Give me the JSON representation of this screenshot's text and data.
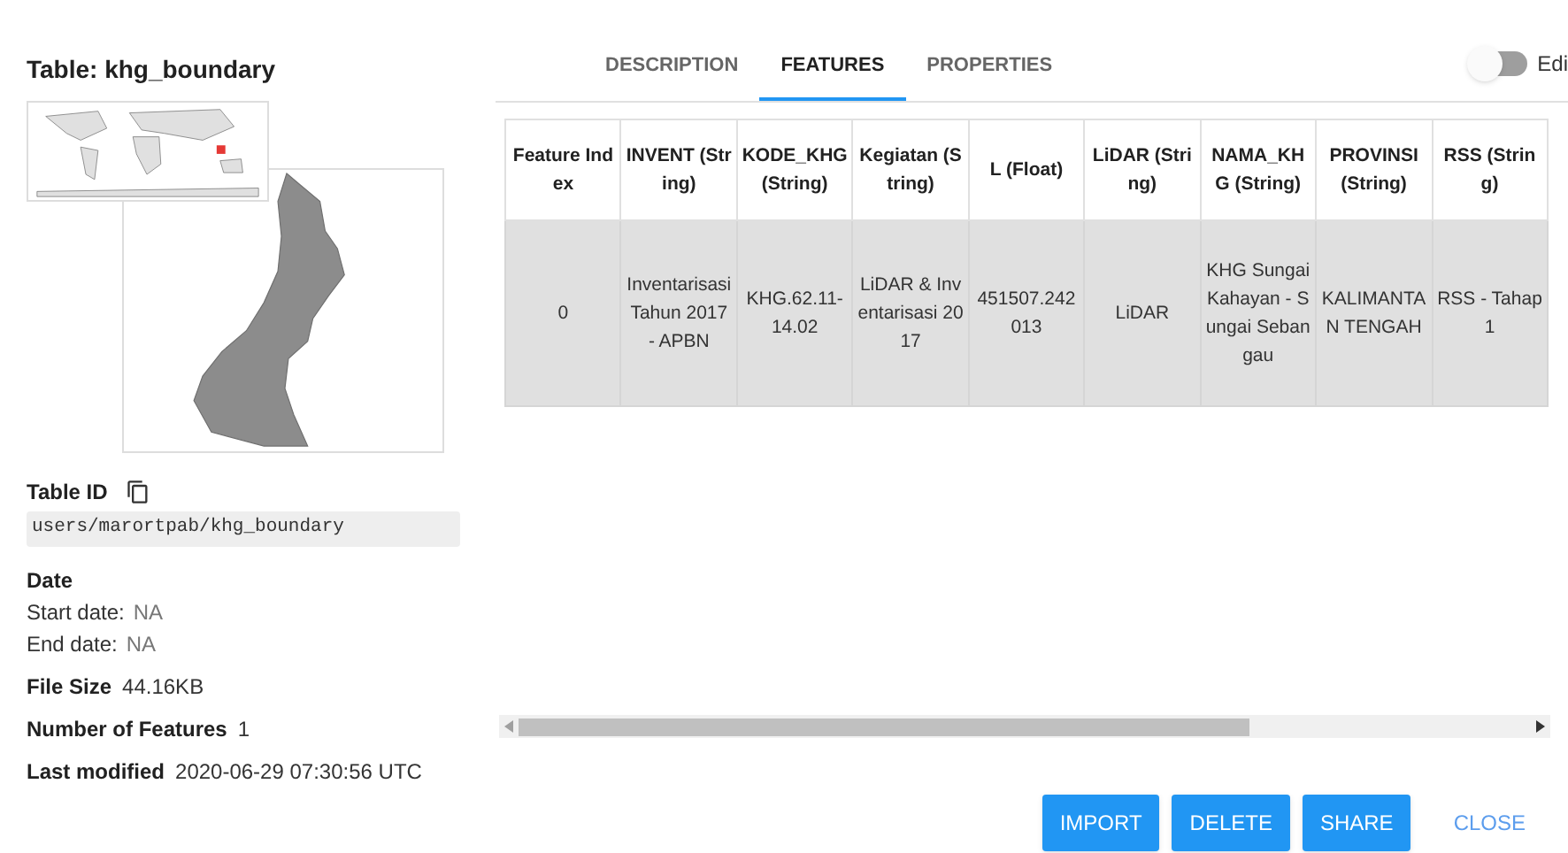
{
  "title": "Table: khg_boundary",
  "details": {
    "table_id_label": "Table ID",
    "table_id": "users/marortpab/khg_boundary",
    "date_label": "Date",
    "fields": [
      {
        "label": "Start date:",
        "value": "NA"
      },
      {
        "label": "End date:",
        "value": "NA"
      }
    ],
    "stats": [
      {
        "label": "File Size",
        "value": "44.16KB"
      },
      {
        "label": "Number of Features",
        "value": "1"
      },
      {
        "label": "Last modified",
        "value": "2020-06-29 07:30:56 UTC"
      }
    ]
  },
  "tabs": [
    {
      "label": "DESCRIPTION",
      "selected": false
    },
    {
      "label": "FEATURES",
      "selected": true
    },
    {
      "label": "PROPERTIES",
      "selected": false
    }
  ],
  "edit_toggle": {
    "label": "Edi",
    "on": false
  },
  "table": {
    "columns": [
      "Feature Index",
      "INVENT (String)",
      "KODE_KHG (String)",
      "Kegiatan (String)",
      "L (Float)",
      "LiDAR (String)",
      "NAMA_KHG (String)",
      "PROVINSI (String)",
      "RSS (String)"
    ],
    "rows": [
      [
        "0",
        "Inventarisasi Tahun 2017 - APBN",
        "KHG.62.11-14.02",
        "LiDAR & Inventarisasi 2017",
        "451507.242013",
        "LiDAR",
        "KHG Sungai Kahayan - Sungai Sebangau",
        "KALIMANTAN TENGAH",
        "RSS - Tahap 1"
      ]
    ]
  },
  "buttons": [
    {
      "label": "IMPORT",
      "kind": "raised"
    },
    {
      "label": "DELETE",
      "kind": "raised"
    },
    {
      "label": "SHARE",
      "kind": "raised"
    },
    {
      "label": "CLOSE",
      "kind": "flat"
    }
  ]
}
